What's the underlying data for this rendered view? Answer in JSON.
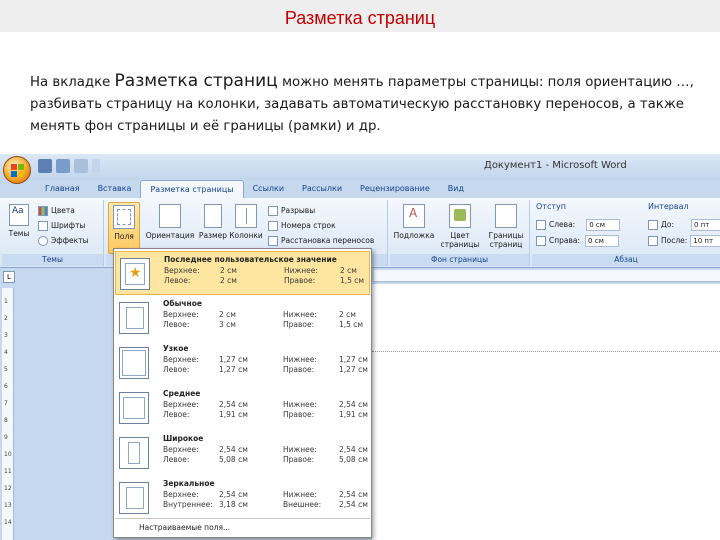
{
  "slide": {
    "title": "Разметка страниц",
    "text_prefix": "На вкладке",
    "text_highlight": "Разметка страниц",
    "text_rest": "можно менять параметры страницы: поля ориентацию …, разбивать страницу на колонки, задавать автоматическую расстановку переносов,  а также менять фон страницы и её границы (рамки) и др."
  },
  "window": {
    "title": "Документ1 - Microsoft Word"
  },
  "tabs": [
    "Главная",
    "Вставка",
    "Разметка страницы",
    "Ссылки",
    "Рассылки",
    "Рецензирование",
    "Вид"
  ],
  "ribbon": {
    "themes": {
      "themes_label": "Темы",
      "colors_label": "Цвета",
      "fonts_label": "Шрифты",
      "effects_label": "Эффекты",
      "group_label": "Темы"
    },
    "page_setup": {
      "margins_label": "Поля",
      "orientation_label": "Ориентация",
      "size_label": "Размер",
      "columns_label": "Колонки",
      "breaks_label": "Разрывы",
      "line_numbers_label": "Номера строк",
      "hyphenation_label": "Расстановка переносов"
    },
    "background": {
      "watermark_label": "Подложка",
      "page_color_label": "Цвет страницы",
      "page_borders_label": "Границы страниц",
      "group_label": "Фон страницы"
    },
    "paragraph": {
      "indent_title": "Отступ",
      "left_label": "Слева:",
      "left_value": "0 см",
      "right_label": "Справа:",
      "right_value": "0 см",
      "spacing_title": "Интервал",
      "before_label": "До:",
      "before_value": "0 пт",
      "after_label": "После:",
      "after_value": "10 пт",
      "group_label": "Абзац"
    }
  },
  "margins_menu": {
    "items": [
      {
        "name": "Последнее пользовательское значение",
        "l1": "Верхнее:",
        "v1": "2 см",
        "l2": "Нижнее:",
        "v2": "2 см",
        "l3": "Левое:",
        "v3": "2 см",
        "l4": "Правое:",
        "v4": "1,5 см",
        "selected": true
      },
      {
        "name": "Обычное",
        "l1": "Верхнее:",
        "v1": "2 см",
        "l2": "Нижнее:",
        "v2": "2 см",
        "l3": "Левое:",
        "v3": "3 см",
        "l4": "Правое:",
        "v4": "1,5 см",
        "selected": false
      },
      {
        "name": "Узкое",
        "l1": "Верхнее:",
        "v1": "1,27 см",
        "l2": "Нижнее:",
        "v2": "1,27 см",
        "l3": "Левое:",
        "v3": "1,27 см",
        "l4": "Правое:",
        "v4": "1,27 см",
        "selected": false
      },
      {
        "name": "Среднее",
        "l1": "Верхнее:",
        "v1": "2,54 см",
        "l2": "Нижнее:",
        "v2": "2,54 см",
        "l3": "Левое:",
        "v3": "1,91 см",
        "l4": "Правое:",
        "v4": "1,91 см",
        "selected": false
      },
      {
        "name": "Широкое",
        "l1": "Верхнее:",
        "v1": "2,54 см",
        "l2": "Нижнее:",
        "v2": "2,54 см",
        "l3": "Левое:",
        "v3": "5,08 см",
        "l4": "Правое:",
        "v4": "5,08 см",
        "selected": false
      },
      {
        "name": "Зеркальное",
        "l1": "Верхнее:",
        "v1": "2,54 см",
        "l2": "Нижнее:",
        "v2": "2,54 см",
        "l3": "Внутреннее:",
        "v3": "3,18 см",
        "l4": "Внешнее:",
        "v4": "2,54 см",
        "selected": false
      }
    ],
    "custom_label": "Настраиваемые поля..."
  },
  "ruler": {
    "corner": "L",
    "numbers": [
      "1",
      "2",
      "3",
      "4",
      "5",
      "6",
      "7",
      "8",
      "9",
      "10",
      "11",
      "12",
      "13",
      "14"
    ]
  },
  "colors": {
    "title": "#c00000",
    "ribbon_tab_text": "#15428b",
    "selected_item": "#ffe6a0",
    "window_frame": "#c6d8ee"
  }
}
